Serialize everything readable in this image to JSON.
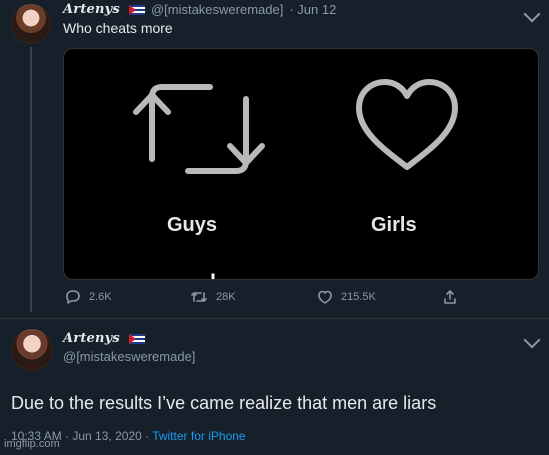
{
  "tweet1": {
    "display_name": "Artenys",
    "handle": "@[mistakesweremade]",
    "date": "· Jun 12",
    "text": "Who cheats more",
    "card": {
      "left_label": "Guys",
      "right_label": "Girls",
      "left_icon": "retweet-icon",
      "right_icon": "heart-icon"
    },
    "actions": {
      "replies": "2.6K",
      "retweets": "28K",
      "likes": "215.5K"
    }
  },
  "tweet2": {
    "display_name": "Artenys",
    "handle": "@[mistakesweremade]",
    "text": "Due to the results I’ve came realize that men are liars",
    "time": "10:33 AM · Jun 13, 2020 · ",
    "source": "Twitter for iPhone"
  },
  "watermark": "imgflip.com",
  "colors": {
    "background": "#15202b",
    "accent": "#1d9bf0",
    "muted": "#8b98a5"
  }
}
